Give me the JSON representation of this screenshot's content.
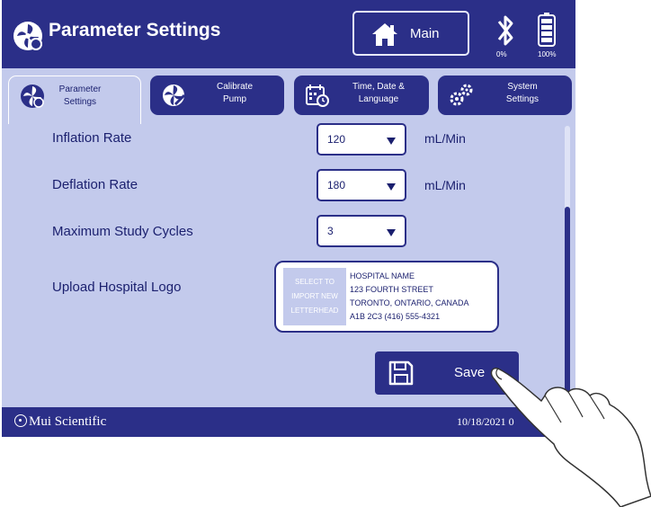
{
  "header": {
    "title": "Parameter Settings",
    "main_label": "Main",
    "bluetooth_percent": "0%",
    "battery_percent": "100%"
  },
  "tabs": [
    {
      "label_line1": "Parameter",
      "label_line2": "Settings",
      "icon": "fan-icon",
      "active": true
    },
    {
      "label_line1": "Calibrate",
      "label_line2": "Pump",
      "icon": "pump-icon",
      "active": false
    },
    {
      "label_line1": "Time, Date &",
      "label_line2": "Language",
      "icon": "calendar-clock-icon",
      "active": false
    },
    {
      "label_line1": "System",
      "label_line2": "Settings",
      "icon": "gears-icon",
      "active": false
    }
  ],
  "settings": {
    "inflation_rate": {
      "label": "Inflation Rate",
      "value": "120",
      "unit": "mL/Min"
    },
    "deflation_rate": {
      "label": "Deflation Rate",
      "value": "180",
      "unit": "mL/Min"
    },
    "max_cycles": {
      "label": "Maximum Study Cycles",
      "value": "3"
    },
    "hospital_logo": {
      "label": "Upload Hospital Logo",
      "import_line1": "SELECT TO",
      "import_line2": "IMPORT NEW",
      "import_line3": "LETTERHEAD",
      "address_line1": "HOSPITAL NAME",
      "address_line2": "123 FOURTH STREET",
      "address_line3": "TORONTO, ONTARIO, CANADA",
      "address_line4": "A1B 2C3  (416) 555-4321"
    }
  },
  "save_label": "Save",
  "footer": {
    "brand": "Mui Scientific",
    "datetime": "10/18/2021 0"
  },
  "colors": {
    "primary": "#2b2f88",
    "panel": "#c3caec",
    "text": "#1a1f6e"
  }
}
